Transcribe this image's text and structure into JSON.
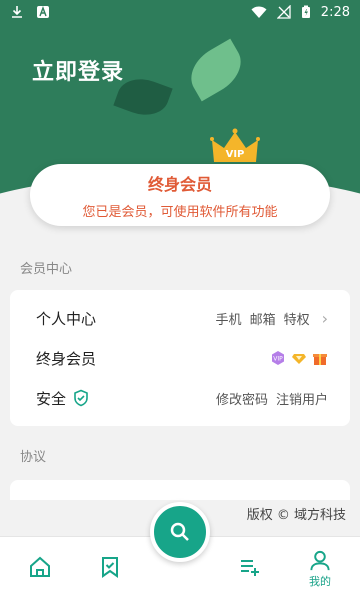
{
  "status_bar": {
    "time": "2:28"
  },
  "header": {
    "login_label": "立即登录"
  },
  "vip_card": {
    "badge": "VIP",
    "title": "终身会员",
    "subtitle": "您已是会员，可使用软件所有功能"
  },
  "sections": {
    "member_center": "会员中心",
    "protocol": "协议"
  },
  "rows": [
    {
      "label": "个人中心",
      "right_items": [
        "手机",
        "邮箱",
        "特权"
      ]
    },
    {
      "label": "终身会员"
    },
    {
      "label": "安全",
      "right_items": [
        "修改密码",
        "注销用户"
      ]
    }
  ],
  "copyright": "版权 © 域方科技",
  "bottom_nav": {
    "mine_label": "我的"
  },
  "colors": {
    "header_green": "#2e7d5b",
    "accent_teal": "#17a589",
    "vip_orange": "#e05a36"
  }
}
